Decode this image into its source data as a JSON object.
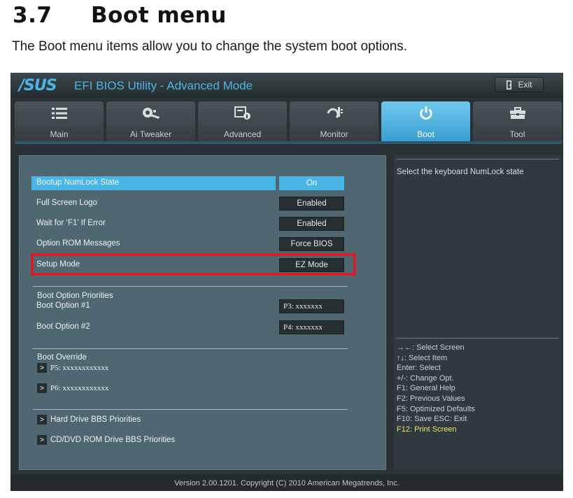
{
  "doc": {
    "section_number": "3.7",
    "section_title": "Boot menu",
    "description": "The Boot menu items allow you to change the system boot options."
  },
  "bios": {
    "logo": "/SUS",
    "title": "EFI BIOS Utility - Advanced Mode",
    "exit_label": "Exit",
    "tabs": [
      {
        "label": "Main",
        "icon": "list-icon"
      },
      {
        "label": "Ai  Tweaker",
        "icon": "tweaker-icon"
      },
      {
        "label": "Advanced",
        "icon": "advanced-icon"
      },
      {
        "label": "Monitor",
        "icon": "monitor-icon"
      },
      {
        "label": "Boot",
        "icon": "power-icon",
        "active": true
      },
      {
        "label": "Tool",
        "icon": "tool-icon"
      }
    ],
    "settings": [
      {
        "label": "Bootup NumLock State",
        "value": "On",
        "selected": true
      },
      {
        "label": "Full Screen Logo",
        "value": "Enabled"
      },
      {
        "label": "Wait for ‘F1’ If Error",
        "value": "Enabled"
      },
      {
        "label": "Option ROM Messages",
        "value": "Force BIOS"
      },
      {
        "label": "Setup Mode",
        "value": "EZ Mode",
        "highlighted": true
      }
    ],
    "boot_priorities": {
      "title": "Boot Option Priorities",
      "options": [
        {
          "label": "Boot Option #1",
          "value": "P3:  xxxxxxx"
        },
        {
          "label": "Boot Option #2",
          "value": "P4:  xxxxxxx"
        }
      ]
    },
    "boot_override": {
      "title": "Boot Override",
      "items": [
        "P5:  xxxxxxxxxxxx",
        "P6:  xxxxxxxxxxxx"
      ]
    },
    "submenus": [
      "Hard Drive BBS Priorities",
      "CD/DVD ROM Drive BBS Priorities"
    ],
    "help_text": "Select the keyboard NumLock state",
    "keys": [
      "→←:  Select Screen",
      "↑↓:  Select Item",
      "Enter:  Select",
      "+/-:  Change Opt.",
      "F1:  General Help",
      "F2:  Previous Values",
      "F5:  Optimized Defaults",
      "F10:  Save    ESC:  Exit",
      "F12: Print Screen"
    ],
    "footer": "Version  2.00.1201.  Copyright  (C)  2010  American  Megatrends,  Inc.",
    "colors": {
      "accent": "#4ab6e6",
      "highlight_box": "#d1222c",
      "key_accent": "#f2e36a"
    }
  }
}
